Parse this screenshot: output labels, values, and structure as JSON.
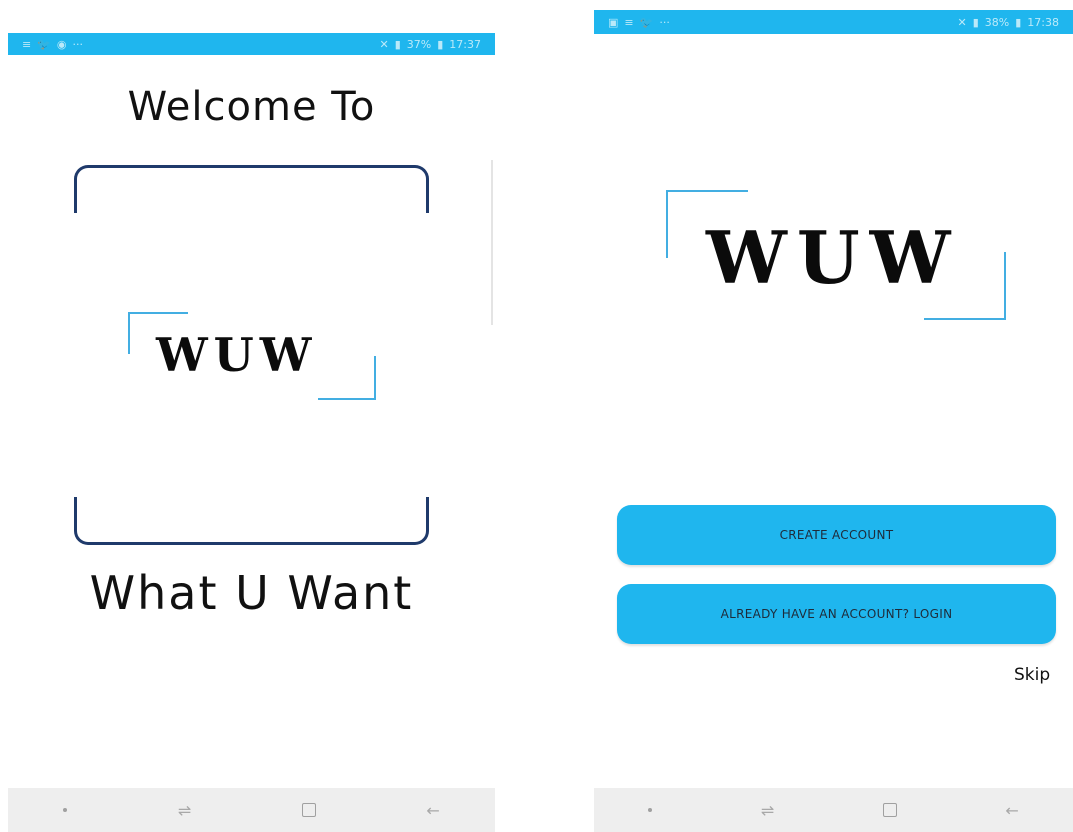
{
  "left_screen": {
    "status_bar": {
      "left_icons": [
        "≡",
        "🐦",
        "◉",
        "···"
      ],
      "right_text": "37%",
      "time": "17:37"
    },
    "welcome_title": "Welcome To",
    "logo_text": "WUW",
    "welcome_subtitle": "What U Want"
  },
  "right_screen": {
    "status_bar": {
      "left_icons": [
        "▣",
        "≡",
        "🐦",
        "···"
      ],
      "right_text": "38%",
      "time": "17:38"
    },
    "logo_text": "WUW",
    "buttons": {
      "create_account": "CREATE ACCOUNT",
      "login": "ALREADY HAVE AN ACCOUNT? LOGIN"
    },
    "skip_label": "Skip"
  },
  "nav_bar": {
    "icons": [
      "recent-apps-dot-icon",
      "recents-icon",
      "home-icon",
      "back-icon"
    ]
  },
  "colors": {
    "accent": "#1fb6ee",
    "bracket": "#1f3a6b",
    "logo_corner": "#43aee2"
  }
}
